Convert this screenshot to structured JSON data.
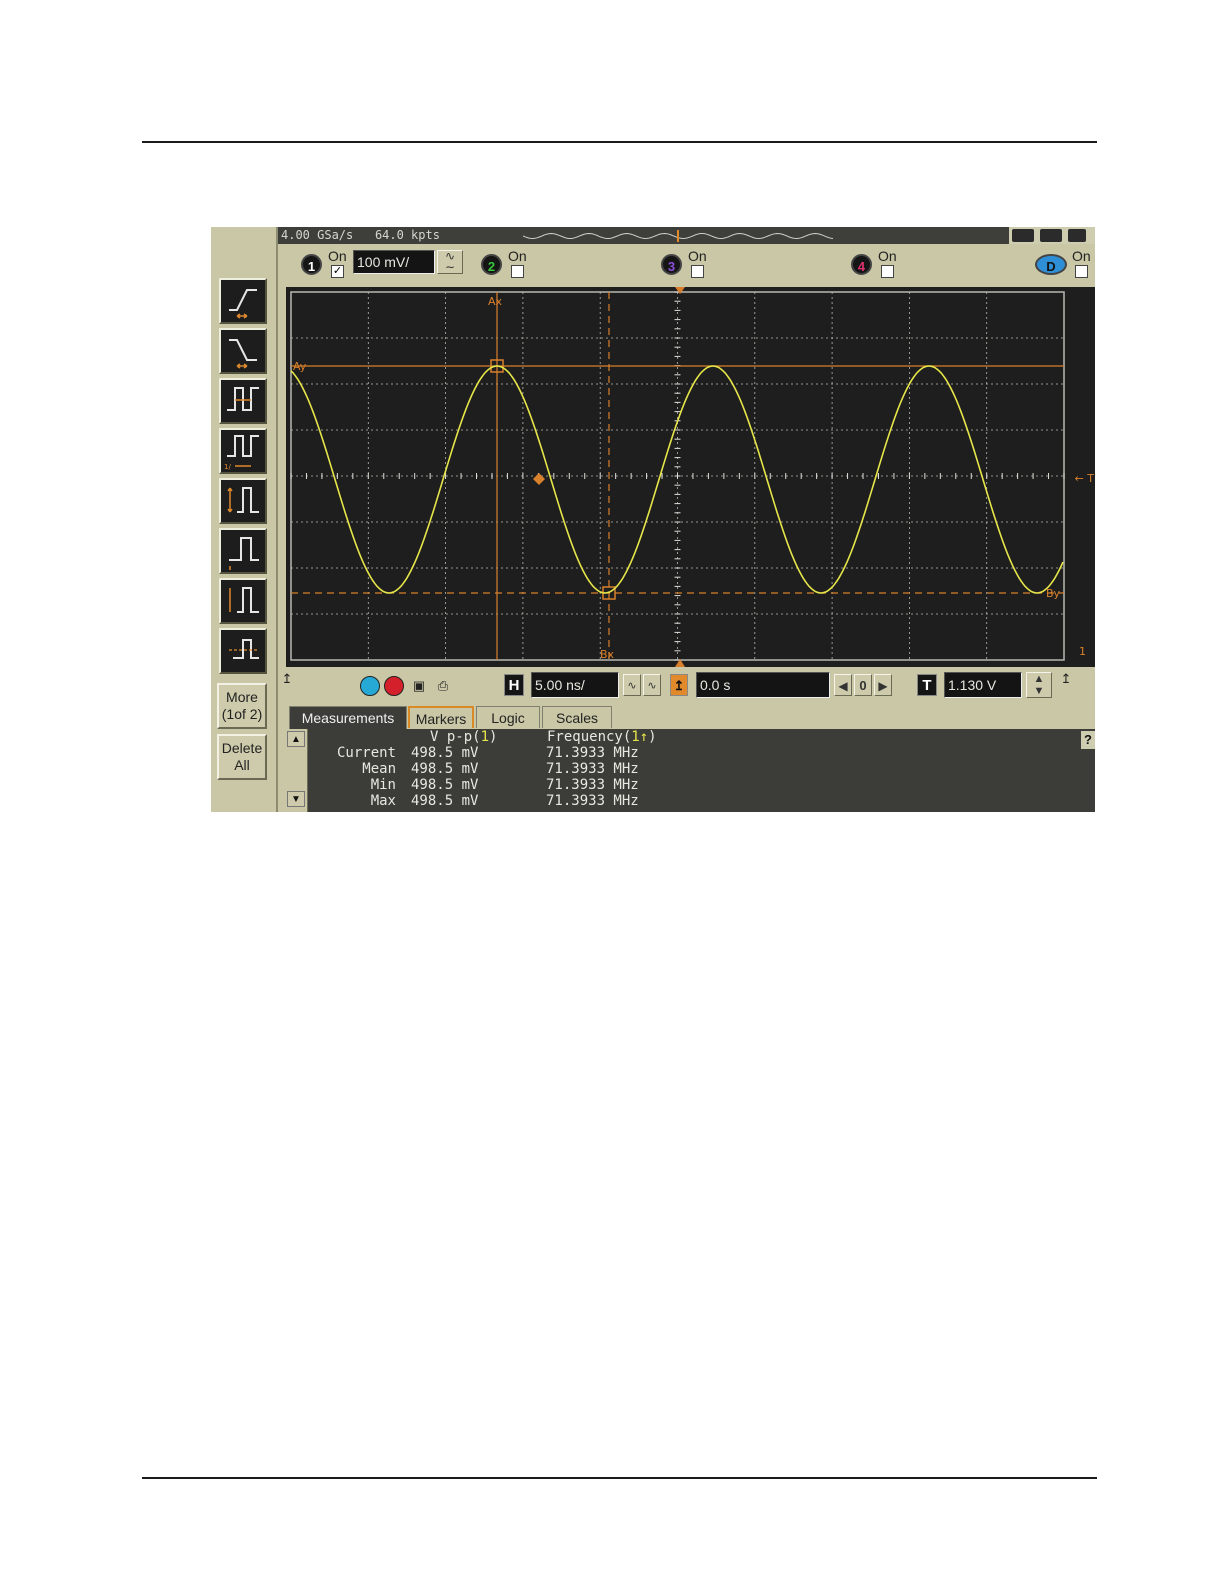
{
  "top_status": {
    "sample_rate": "4.00 GSa/s",
    "memory": "64.0 kpts"
  },
  "channels": [
    {
      "number": "1",
      "on_label": "On",
      "checked": true,
      "scale": "100 mV/",
      "color": "#e8e84a"
    },
    {
      "number": "2",
      "on_label": "On",
      "checked": false,
      "color": "#35c43c"
    },
    {
      "number": "3",
      "on_label": "On",
      "checked": false,
      "color": "#8a4fd9"
    },
    {
      "number": "4",
      "on_label": "On",
      "checked": false,
      "color": "#e0306e"
    },
    {
      "number": "D",
      "on_label": "On",
      "checked": false,
      "color": "#2f8fd6"
    }
  ],
  "graticule": {
    "marker_labels": {
      "ax": "Ax",
      "ay": "Ay",
      "bx": "Bx",
      "by": "By"
    },
    "trigger_label": "← T",
    "ground_marker": "1",
    "colors": {
      "trace": "#e6e64a",
      "marker": "#d8802c",
      "grid": "#b9b9b0",
      "background": "#1e1e1e"
    }
  },
  "left_toolbar": {
    "more_button": "More\n(1of 2)",
    "delete_button": "Delete\nAll"
  },
  "controls": {
    "h_label": "H",
    "time_scale": "5.00 ns/",
    "delay": "0.0 s",
    "delay_zero": "0",
    "t_label": "T",
    "trigger_level": "1.130 V"
  },
  "tabs": [
    {
      "label": "Measurements",
      "active": true
    },
    {
      "label": "Markers",
      "active": false
    },
    {
      "label": "Logic",
      "active": false
    },
    {
      "label": "Scales",
      "active": false
    }
  ],
  "measurements": {
    "columns": [
      {
        "name": "V p-p",
        "source": "1"
      },
      {
        "name": "Frequency",
        "source": "1↑"
      }
    ],
    "rows": [
      {
        "label": "Current",
        "vpp": "498.5 mV",
        "freq": "71.3933 MHz"
      },
      {
        "label": "Mean",
        "vpp": "498.5 mV",
        "freq": "71.3933 MHz"
      },
      {
        "label": "Min",
        "vpp": "498.5 mV",
        "freq": "71.3933 MHz"
      },
      {
        "label": "Max",
        "vpp": "498.5 mV",
        "freq": "71.3933 MHz"
      }
    ],
    "help": "?"
  }
}
